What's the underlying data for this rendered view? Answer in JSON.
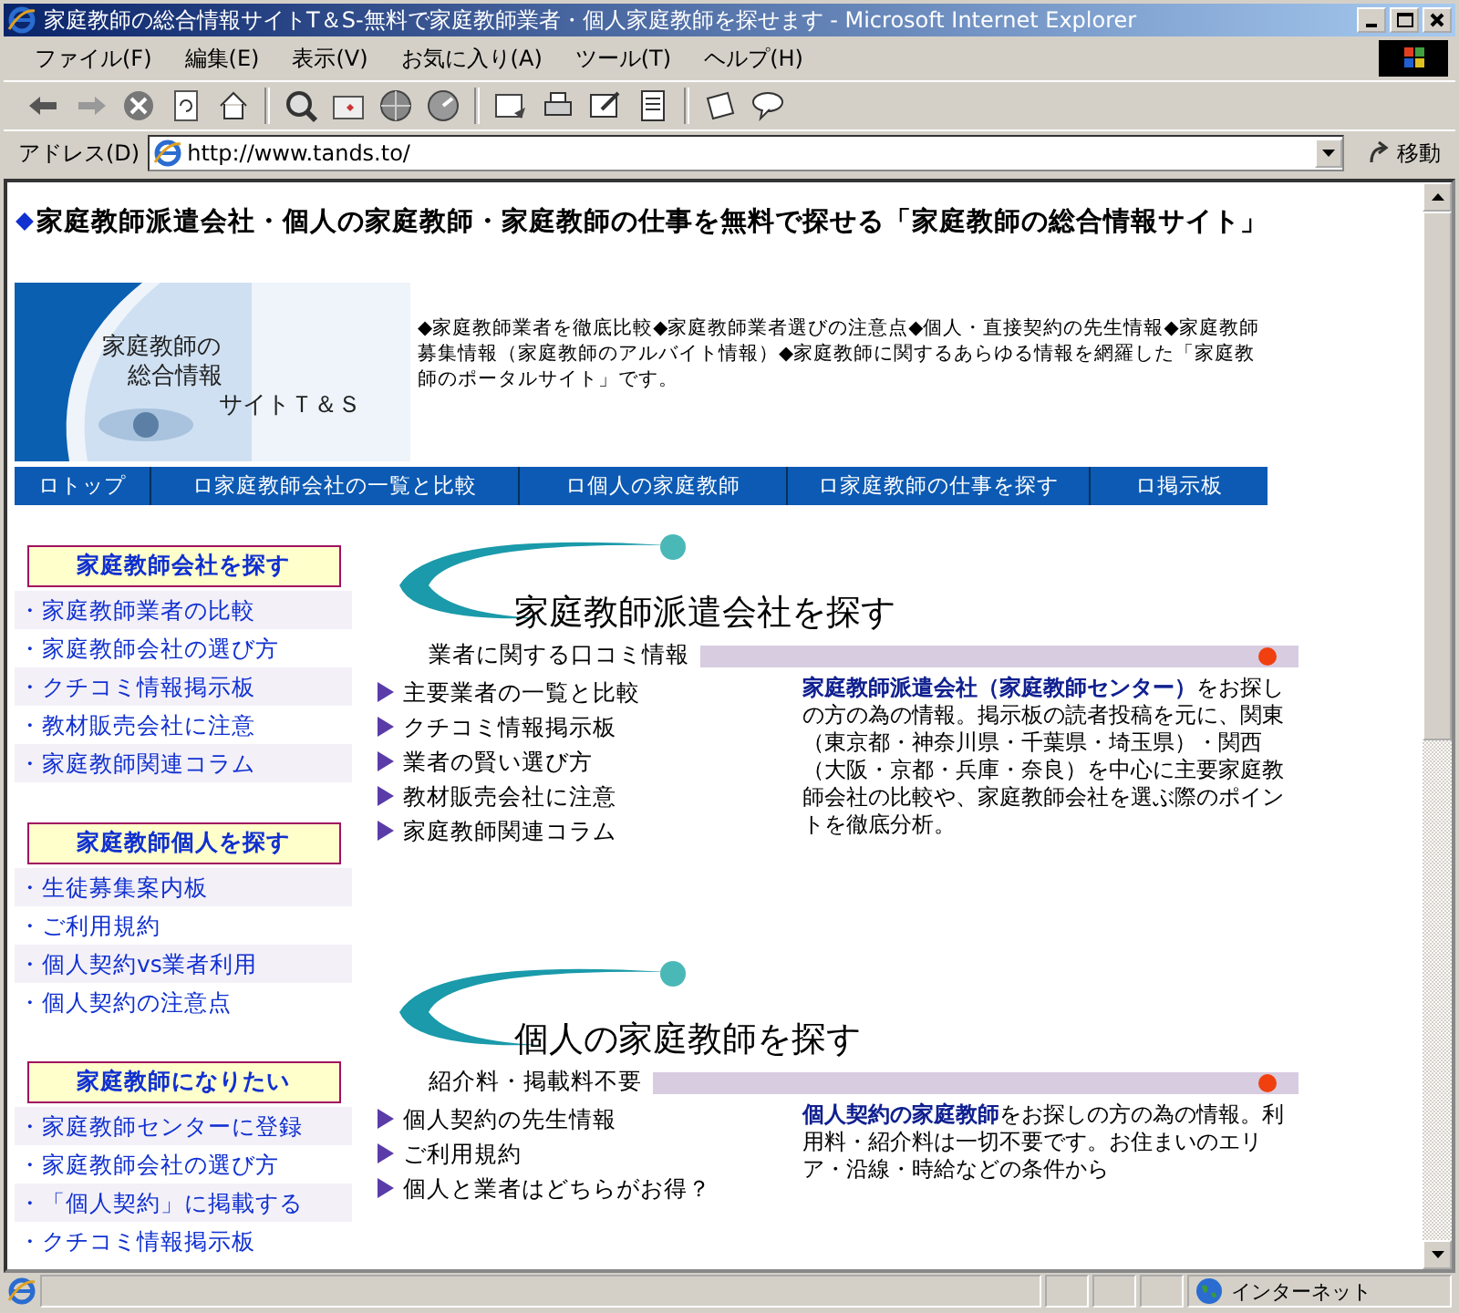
{
  "window": {
    "title": "家庭教師の総合情報サイトT＆S-無料で家庭教師業者・個人家庭教師を探せます - Microsoft Internet Explorer"
  },
  "menu": [
    "ファイル(F)",
    "編集(E)",
    "表示(V)",
    "お気に入り(A)",
    "ツール(T)",
    "ヘルプ(H)"
  ],
  "address": {
    "label": "アドレス(D)",
    "value": "http://www.tands.to/",
    "go": "移動"
  },
  "page": {
    "heading": "家庭教師派遣会社・個人の家庭教師・家庭教師の仕事を無料で探せる「家庭教師の総合情報サイト」",
    "logo_lines": [
      "家庭教師の",
      "総合情報",
      "サイトＴ＆Ｓ"
    ],
    "intro": "◆家庭教師業者を徹底比較◆家庭教師業者選びの注意点◆個人・直接契約の先生情報◆家庭教師募集情報（家庭教師のアルバイト情報）◆家庭教師に関するあらゆる情報を網羅した「家庭教師のポータルサイト」です。",
    "nav": [
      "ロトップ",
      "ロ家庭教師会社の一覧と比較",
      "ロ個人の家庭教師",
      "ロ家庭教師の仕事を探す",
      "ロ掲示板"
    ],
    "sidebar": [
      {
        "title": "家庭教師会社を探す",
        "items": [
          "・家庭教師業者の比較",
          "・家庭教師会社の選び方",
          "・クチコミ情報掲示板",
          "・教材販売会社に注意",
          "・家庭教師関連コラム"
        ]
      },
      {
        "title": "家庭教師個人を探す",
        "items": [
          "・生徒募集案内板",
          "・ご利用規約",
          "・個人契約vs業者利用",
          "・個人契約の注意点"
        ]
      },
      {
        "title": "家庭教師になりたい",
        "items": [
          "・家庭教師センターに登録",
          "・家庭教師会社の選び方",
          "・「個人契約」に掲載する",
          "・クチコミ情報掲示板"
        ]
      }
    ],
    "sections": [
      {
        "title": "家庭教師派遣会社を探す",
        "subtitle": "業者に関する口コミ情報",
        "links": [
          "主要業者の一覧と比較",
          "クチコミ情報掲示板",
          "業者の賢い選び方",
          "教材販売会社に注意",
          "家庭教師関連コラム"
        ],
        "lead": "家庭教師派遣会社（家庭教師センター）",
        "text": "をお探しの方の為の情報。掲示板の読者投稿を元に、関東（東京都・神奈川県・千葉県・埼玉県）・関西（大阪・京都・兵庫・奈良）を中心に主要家庭教師会社の比較や、家庭教師会社を選ぶ際のポイントを徹底分析。"
      },
      {
        "title": "個人の家庭教師を探す",
        "subtitle": "紹介料・掲載料不要",
        "links": [
          "個人契約の先生情報",
          "ご利用規約",
          "個人と業者はどちらがお得？"
        ],
        "lead": "個人契約の家庭教師",
        "text": "をお探しの方の為の情報。利用料・紹介料は一切不要です。お住まいのエリア・沿線・時給などの条件から"
      }
    ]
  },
  "status_bar": {
    "zone": "インターネット"
  }
}
